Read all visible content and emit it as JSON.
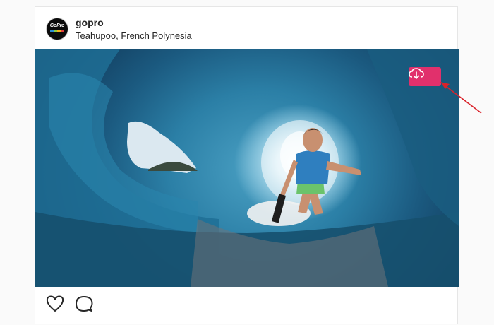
{
  "post": {
    "username": "gopro",
    "location": "Teahupoo, French Polynesia",
    "avatar_text": "GoPro"
  },
  "media": {
    "type": "video",
    "accent_color": "#e1306c"
  },
  "icons": {
    "download": "cloud-download-icon",
    "like": "heart-outline-icon",
    "comment": "comment-bubble-icon",
    "annotation": "red-arrow-pointer"
  }
}
